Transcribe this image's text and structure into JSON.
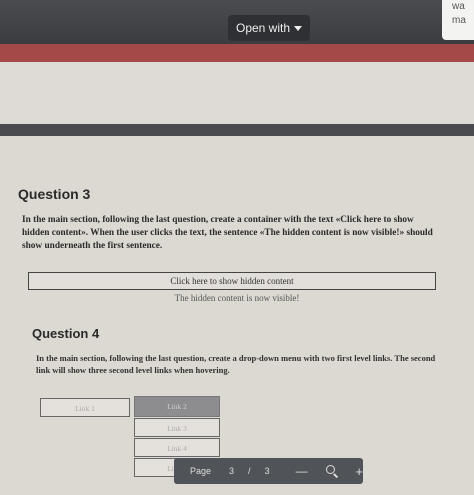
{
  "toolbar": {
    "open_with_label": "Open with"
  },
  "corner_card": {
    "line1": "wa",
    "line2": "ma"
  },
  "question3": {
    "title": "Question 3",
    "body": "In the main section, following the last question, create a container with the text «Click here to show hidden content». When the user clicks the text, the sentence «The hidden content is now visible!» should show underneath the first sentence.",
    "button_label": "Click here to show hidden content",
    "hidden_text": "The hidden content is now visible!"
  },
  "question4": {
    "title": "Question 4",
    "body": "In the main section, following the last question, create a drop-down menu with two first level links. The second link will show three second level links when hovering.",
    "menu": {
      "link1": "Link 1",
      "link2": "Link 2",
      "sublinks": [
        "Link 3",
        "Link 4",
        "Link 5"
      ]
    }
  },
  "pager": {
    "label": "Page",
    "current": "3",
    "separator": "/",
    "total": "3",
    "minus": "—",
    "plus": "+"
  }
}
